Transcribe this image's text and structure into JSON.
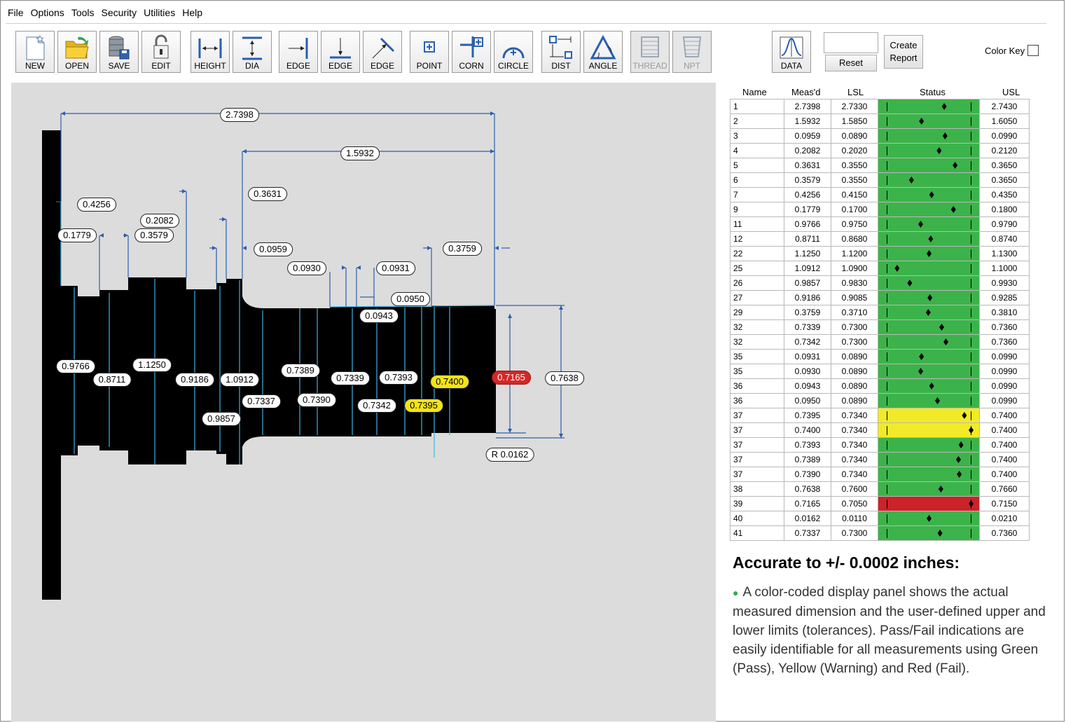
{
  "menu": [
    "File",
    "Options",
    "Tools",
    "Security",
    "Utilities",
    "Help"
  ],
  "toolbar": {
    "new": "NEW",
    "open": "OPEN",
    "save": "SAVE",
    "edit": "EDIT",
    "height": "HEIGHT",
    "dia": "DIA",
    "edge1": "EDGE",
    "edge2": "EDGE",
    "edge3": "EDGE",
    "point": "POINT",
    "corn": "CORN",
    "circle": "CIRCLE",
    "dist": "DIST",
    "angle": "ANGLE",
    "thread": "THREAD",
    "npt": "NPT",
    "data": "DATA"
  },
  "controls": {
    "reset": "Reset",
    "report_line1": "Create",
    "report_line2": "Report",
    "color_key": "Color Key"
  },
  "table": {
    "headers": {
      "name": "Name",
      "measd": "Meas'd",
      "lsl": "LSL",
      "status": "Status",
      "usl": "USL"
    },
    "rows": [
      {
        "name": "1",
        "meas": "2.7398",
        "lsl": "2.7330",
        "usl": "2.7430",
        "status": "green",
        "pos": 0.68
      },
      {
        "name": "2",
        "meas": "1.5932",
        "lsl": "1.5850",
        "usl": "1.6050",
        "status": "green",
        "pos": 0.41
      },
      {
        "name": "3",
        "meas": "0.0959",
        "lsl": "0.0890",
        "usl": "0.0990",
        "status": "green",
        "pos": 0.69
      },
      {
        "name": "4",
        "meas": "0.2082",
        "lsl": "0.2020",
        "usl": "0.2120",
        "status": "green",
        "pos": 0.62
      },
      {
        "name": "5",
        "meas": "0.3631",
        "lsl": "0.3550",
        "usl": "0.3650",
        "status": "green",
        "pos": 0.81
      },
      {
        "name": "6",
        "meas": "0.3579",
        "lsl": "0.3550",
        "usl": "0.3650",
        "status": "green",
        "pos": 0.29
      },
      {
        "name": "7",
        "meas": "0.4256",
        "lsl": "0.4150",
        "usl": "0.4350",
        "status": "green",
        "pos": 0.53
      },
      {
        "name": "9",
        "meas": "0.1779",
        "lsl": "0.1700",
        "usl": "0.1800",
        "status": "green",
        "pos": 0.79
      },
      {
        "name": "11",
        "meas": "0.9766",
        "lsl": "0.9750",
        "usl": "0.9790",
        "status": "green",
        "pos": 0.4
      },
      {
        "name": "12",
        "meas": "0.8711",
        "lsl": "0.8680",
        "usl": "0.8740",
        "status": "green",
        "pos": 0.52
      },
      {
        "name": "22",
        "meas": "1.1250",
        "lsl": "1.1200",
        "usl": "1.1300",
        "status": "green",
        "pos": 0.5
      },
      {
        "name": "25",
        "meas": "1.0912",
        "lsl": "1.0900",
        "usl": "1.1000",
        "status": "green",
        "pos": 0.12
      },
      {
        "name": "26",
        "meas": "0.9857",
        "lsl": "0.9830",
        "usl": "0.9930",
        "status": "green",
        "pos": 0.27
      },
      {
        "name": "27",
        "meas": "0.9186",
        "lsl": "0.9085",
        "usl": "0.9285",
        "status": "green",
        "pos": 0.51
      },
      {
        "name": "29",
        "meas": "0.3759",
        "lsl": "0.3710",
        "usl": "0.3810",
        "status": "green",
        "pos": 0.49
      },
      {
        "name": "32",
        "meas": "0.7339",
        "lsl": "0.7300",
        "usl": "0.7360",
        "status": "green",
        "pos": 0.65
      },
      {
        "name": "32",
        "meas": "0.7342",
        "lsl": "0.7300",
        "usl": "0.7360",
        "status": "green",
        "pos": 0.7
      },
      {
        "name": "35",
        "meas": "0.0931",
        "lsl": "0.0890",
        "usl": "0.0990",
        "status": "green",
        "pos": 0.41
      },
      {
        "name": "35",
        "meas": "0.0930",
        "lsl": "0.0890",
        "usl": "0.0990",
        "status": "green",
        "pos": 0.4
      },
      {
        "name": "36",
        "meas": "0.0943",
        "lsl": "0.0890",
        "usl": "0.0990",
        "status": "green",
        "pos": 0.53
      },
      {
        "name": "36",
        "meas": "0.0950",
        "lsl": "0.0890",
        "usl": "0.0990",
        "status": "green",
        "pos": 0.6
      },
      {
        "name": "37",
        "meas": "0.7395",
        "lsl": "0.7340",
        "usl": "0.7400",
        "status": "yellow",
        "pos": 0.92
      },
      {
        "name": "37",
        "meas": "0.7400",
        "lsl": "0.7340",
        "usl": "0.7400",
        "status": "yellow",
        "pos": 1.0
      },
      {
        "name": "37",
        "meas": "0.7393",
        "lsl": "0.7340",
        "usl": "0.7400",
        "status": "green",
        "pos": 0.88
      },
      {
        "name": "37",
        "meas": "0.7389",
        "lsl": "0.7340",
        "usl": "0.7400",
        "status": "green",
        "pos": 0.85
      },
      {
        "name": "37",
        "meas": "0.7390",
        "lsl": "0.7340",
        "usl": "0.7400",
        "status": "green",
        "pos": 0.86
      },
      {
        "name": "38",
        "meas": "0.7638",
        "lsl": "0.7600",
        "usl": "0.7660",
        "status": "green",
        "pos": 0.64
      },
      {
        "name": "39",
        "meas": "0.7165",
        "lsl": "0.7050",
        "usl": "0.7150",
        "status": "red",
        "pos": 1.0
      },
      {
        "name": "40",
        "meas": "0.0162",
        "lsl": "0.0110",
        "usl": "0.0210",
        "status": "green",
        "pos": 0.5
      },
      {
        "name": "41",
        "meas": "0.7337",
        "lsl": "0.7300",
        "usl": "0.7360",
        "status": "green",
        "pos": 0.63
      }
    ]
  },
  "status_colors": {
    "green": "#3cb34a",
    "yellow": "#f2ea26",
    "red": "#cc2229"
  },
  "measurements": {
    "m27398": "2.7398",
    "m15932": "1.5932",
    "m03631": "0.3631",
    "m04256": "0.4256",
    "m02082": "0.2082",
    "m01779": "0.1779",
    "m03579": "0.3579",
    "m00959": "0.0959",
    "m03759": "0.3759",
    "m00930": "0.0930",
    "m00931": "0.0931",
    "m00950": "0.0950",
    "m00943": "0.0943",
    "m09766": "0.9766",
    "m08711": "0.8711",
    "m11250": "1.1250",
    "m09186": "0.9186",
    "m10912": "1.0912",
    "m07389": "0.7389",
    "m07339": "0.7339",
    "m07393": "0.7393",
    "m07400": "0.7400",
    "m07165": "0.7165",
    "m07638": "0.7638",
    "m07337": "0.7337",
    "m07390": "0.7390",
    "m07342": "0.7342",
    "m07395": "0.7395",
    "m09857": "0.9857",
    "radius": "R 0.0162"
  },
  "footer": {
    "title": "Accurate to +/- 0.0002 inches:",
    "description": "A color-coded display panel shows the actual measured dimension and the user-defined upper and lower limits (tolerances). Pass/Fail indications are easily identifiable for all measurements using Green (Pass), Yellow (Warning) and Red (Fail)."
  }
}
